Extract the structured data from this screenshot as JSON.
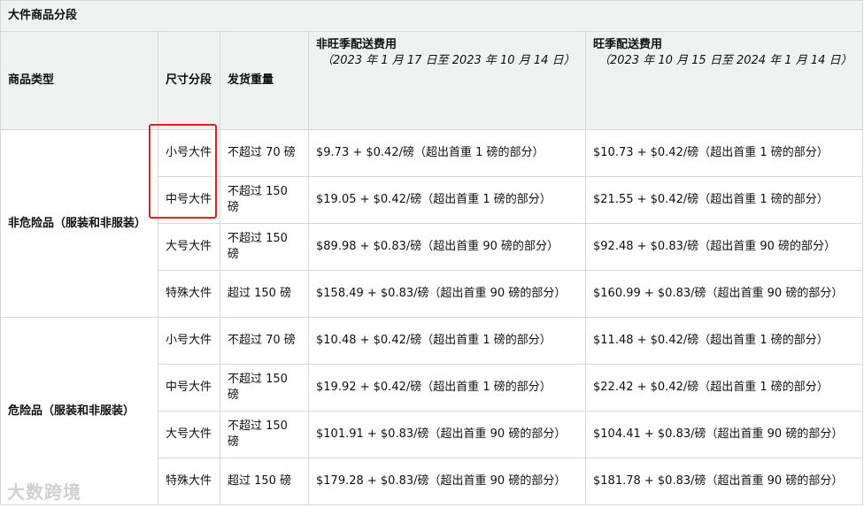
{
  "table": {
    "title": "大件商品分段",
    "headers": {
      "product_type": "商品类型",
      "size_tier": "尺寸分段",
      "shipping_weight": "发货重量",
      "off_peak": "非旺季配送费用",
      "off_peak_dates": "（2023 年 1 月 17 日至 2023 年 10 月 14 日）",
      "peak": "旺季配送费用",
      "peak_dates": "（2023 年 10 月 15 日至 2024 年 1 月 14 日）"
    },
    "groups": [
      {
        "type": "非危险品（服装和非服装）",
        "rows": [
          {
            "tier": "小号大件",
            "weight": "不超过 70 磅",
            "off_peak": "$9.73 + $0.42/磅（超出首重 1 磅的部分）",
            "peak": "$10.73 + $0.42/磅（超出首重 1 磅的部分）"
          },
          {
            "tier": "中号大件",
            "weight": "不超过 150 磅",
            "off_peak": "$19.05 + $0.42/磅（超出首重 1 磅的部分）",
            "peak": "$21.55 + $0.42/磅（超出首重 1 磅的部分）"
          },
          {
            "tier": "大号大件",
            "weight": "不超过 150 磅",
            "off_peak": "$89.98 + $0.83/磅（超出首重 90 磅的部分）",
            "peak": "$92.48 + $0.83/磅（超出首重 90 磅的部分）"
          },
          {
            "tier": "特殊大件",
            "weight": "超过 150 磅",
            "off_peak": "$158.49 + $0.83/磅（超出首重 90 磅的部分）",
            "peak": "$160.99 + $0.83/磅（超出首重 90 磅的部分）"
          }
        ]
      },
      {
        "type": "危险品（服装和非服装）",
        "rows": [
          {
            "tier": "小号大件",
            "weight": "不超过 70 磅",
            "off_peak": "$10.48 + $0.42/磅（超出首重 1 磅的部分）",
            "peak": "$11.48 + $0.42/磅（超出首重 1 磅的部分）"
          },
          {
            "tier": "中号大件",
            "weight": "不超过 150 磅",
            "off_peak": "$19.92 + $0.42/磅（超出首重 1 磅的部分）",
            "peak": "$22.42 + $0.42/磅（超出首重 1 磅的部分）"
          },
          {
            "tier": "大号大件",
            "weight": "不超过 150 磅",
            "off_peak": "$101.91 + $0.83/磅（超出首重 90 磅的部分）",
            "peak": "$104.41 + $0.83/磅（超出首重 90 磅的部分）"
          },
          {
            "tier": "特殊大件",
            "weight": "超过 150 磅",
            "off_peak": "$179.28 + $0.83/磅（超出首重 90 磅的部分）",
            "peak": "$181.78 + $0.83/磅（超出首重 90 磅的部分）"
          }
        ]
      }
    ]
  },
  "watermark": "大数跨境",
  "colors": {
    "highlight": "#e02020",
    "header_bg": "#f0f2f2",
    "border": "#d5d9d9"
  }
}
